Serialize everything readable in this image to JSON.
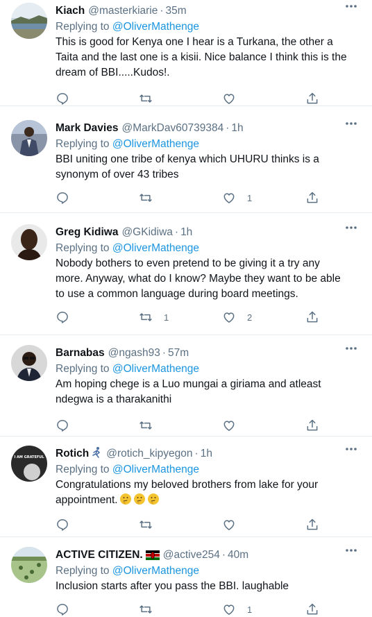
{
  "tweets": [
    {
      "name": "Kiach",
      "handle": "@masterkiarie",
      "dot": "·",
      "time": "35m",
      "replying_prefix": "Replying to ",
      "replying_to": "@OliverMathenge",
      "text_lines": [
        "This is good for Kenya one I hear is a Turkana, the other a",
        "Taita and the last one is a kisii. Nice balance I think this is the",
        "dream of BBI.....Kudos!."
      ],
      "retweets": "",
      "likes": "",
      "avatar_icon": "landscape-photo-icon"
    },
    {
      "name": "Mark Davies",
      "handle": "@MarkDav60739384",
      "dot": "·",
      "time": "1h",
      "replying_prefix": "Replying to ",
      "replying_to": "@OliverMathenge",
      "text_lines": [
        "BBI uniting one tribe of kenya which UHURU thinks is a",
        "synonym of over 43 tribes"
      ],
      "retweets": "",
      "likes": "1",
      "avatar_icon": "man-in-suit-icon"
    },
    {
      "name": "Greg Kidiwa",
      "handle": "@GKidiwa",
      "dot": "·",
      "time": "1h",
      "replying_prefix": "Replying to ",
      "replying_to": "@OliverMathenge",
      "text_lines": [
        "Nobody bothers to even pretend to be giving it a try any",
        "more. Anyway, what do I know? Maybe they want to be able",
        "to use a common language during board meetings."
      ],
      "retweets": "1",
      "likes": "2",
      "avatar_icon": "portrait-icon"
    },
    {
      "name": "Barnabas",
      "handle": "@ngash93",
      "dot": "·",
      "time": "57m",
      "replying_prefix": "Replying to ",
      "replying_to": "@OliverMathenge",
      "text_lines": [
        "Am hoping  chege is a Luo mungai a giriama and atleast",
        "ndegwa is a tharakanithi"
      ],
      "retweets": "",
      "likes": "",
      "avatar_icon": "man-with-glasses-icon"
    },
    {
      "name": "Rotich",
      "handle": "@rotich_kipyegon",
      "dot": "·",
      "time": "1h",
      "replying_prefix": "Replying to ",
      "replying_to": "@OliverMathenge",
      "text_lines": [
        "Congratulations my beloved brothers from lake for your",
        "appointment."
      ],
      "trailing_emoji": [
        "thinking-face-emoji",
        "thinking-face-emoji",
        "thinking-face-emoji"
      ],
      "retweets": "",
      "likes": "",
      "avatar_icon": "grateful-poster-icon",
      "avatar_text_1": "I AM GRATEFUL",
      "name_emoji": "runner-emoji"
    },
    {
      "name": "ACTIVE CITIZEN.",
      "handle": "@active254",
      "dot": "·",
      "time": "40m",
      "replying_prefix": "Replying to ",
      "replying_to": "@OliverMathenge",
      "text_lines": [
        "Inclusion starts after you pass the BBI. laughable"
      ],
      "retweets": "",
      "likes": "1",
      "avatar_icon": "field-photo-icon",
      "name_emoji": "kenya-flag-icon"
    }
  ],
  "colors": {
    "text": "#0f1419",
    "secondary": "#5b7083",
    "link": "#1b95e0",
    "divider": "#e6ecf0"
  }
}
